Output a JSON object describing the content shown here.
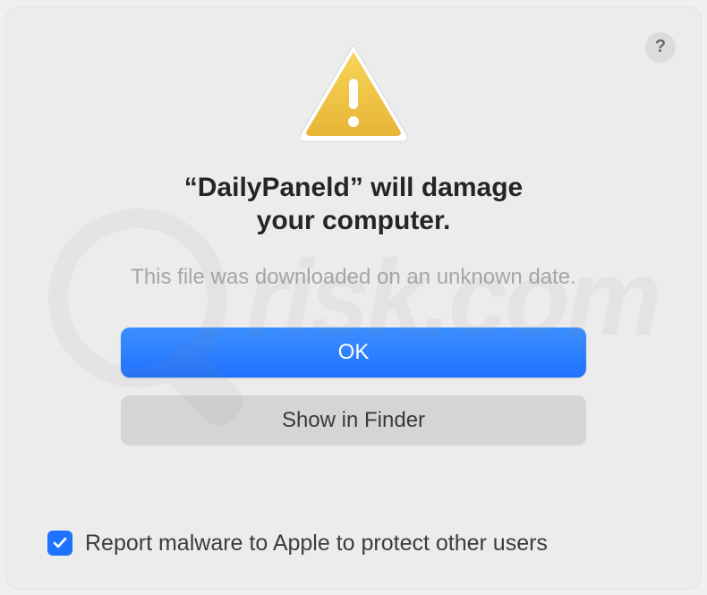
{
  "dialog": {
    "help_icon": "?",
    "title_line1": "“DailyPaneld” will damage",
    "title_line2": "your computer.",
    "subtitle": "This file was downloaded on an unknown date.",
    "primary_button": "OK",
    "secondary_button": "Show in Finder",
    "checkbox_label": "Report malware to Apple to protect other users",
    "checkbox_checked": true
  },
  "watermark": {
    "text": "risk.com"
  }
}
